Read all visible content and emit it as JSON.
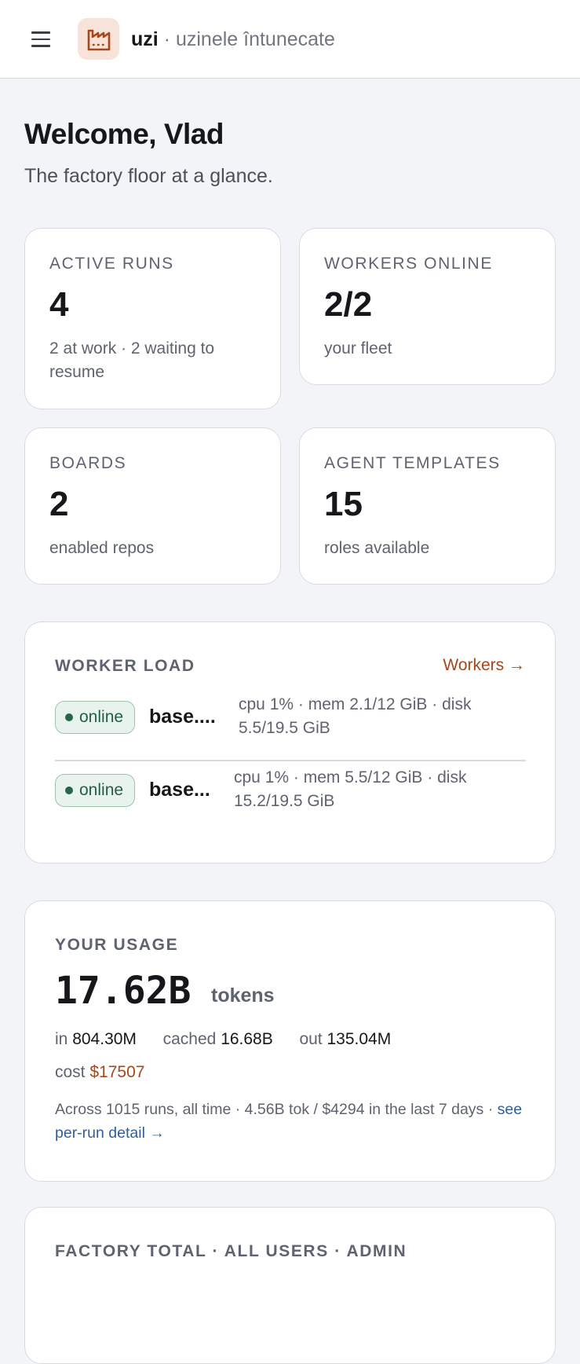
{
  "header": {
    "menu_icon": "hamburger-menu-icon",
    "logo_icon": "factory-icon",
    "brand_name": "uzi",
    "brand_separator": "·",
    "brand_tagline": "uzinele întunecate"
  },
  "welcome": {
    "title": "Welcome, Vlad",
    "subtitle": "The factory floor at a glance."
  },
  "stats": [
    {
      "label": "ACTIVE RUNS",
      "value": "4",
      "sub": "2 at work · 2 waiting to resume"
    },
    {
      "label": "WORKERS ONLINE",
      "value": "2/2",
      "sub": "your fleet"
    },
    {
      "label": "BOARDS",
      "value": "2",
      "sub": "enabled repos"
    },
    {
      "label": "AGENT TEMPLATES",
      "value": "15",
      "sub": "roles available"
    }
  ],
  "worker_load": {
    "title": "WORKER LOAD",
    "link": "Workers →",
    "workers": [
      {
        "status": "online",
        "name": "base....",
        "stats": "cpu 1% · mem 2.1/12 GiB · disk 5.5/19.5 GiB"
      },
      {
        "status": "online",
        "name": "base...",
        "stats": "cpu 1% · mem 5.5/12 GiB · disk 15.2/19.5 GiB"
      }
    ]
  },
  "usage": {
    "title": "YOUR USAGE",
    "total": "17.62B",
    "unit": "tokens",
    "in_label": "in",
    "in_value": "804.30M",
    "cached_label": "cached",
    "cached_value": "16.68B",
    "out_label": "out",
    "out_value": "135.04M",
    "cost_label": "cost",
    "cost_value": "$17507",
    "summary_text": "Across 1015 runs, all time · 4.56B tok / $4294 in the last 7 days ·",
    "summary_link": "see per-run detail →",
    "accent_color": "#a8471b"
  },
  "factory_total": {
    "title": "FACTORY TOTAL · ALL USERS · ADMIN"
  }
}
